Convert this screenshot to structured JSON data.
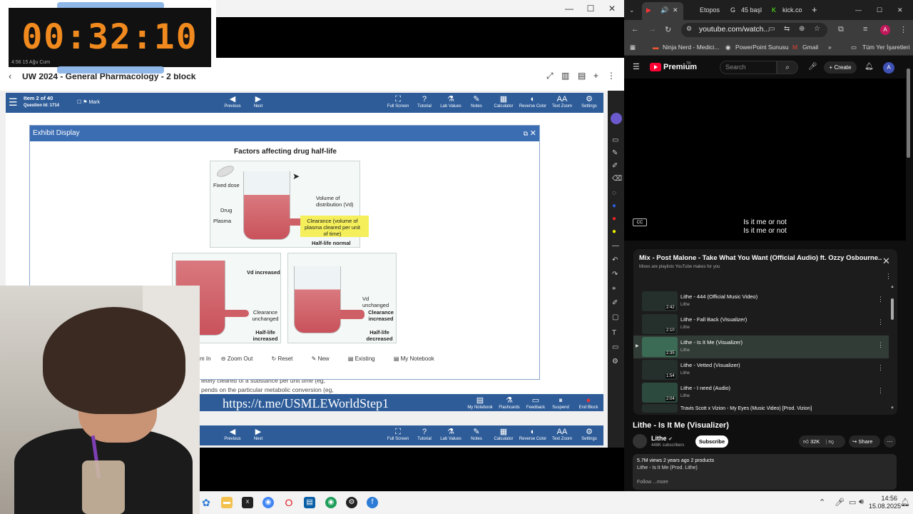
{
  "timer": {
    "time": "00:32:10",
    "date": "4:56 15 Ağu Cum"
  },
  "uworld": {
    "title": "UW 2024 - General Pharmacology - 2 block",
    "item": "Item 2 of 40",
    "question_id": "Question Id: 1714",
    "mark": "Mark",
    "nav": {
      "previous": "Previous",
      "next": "Next"
    },
    "tools": [
      "Full Screen",
      "Tutorial",
      "Lab Values",
      "Notes",
      "Calculator",
      "Reverse Color",
      "Text Zoom",
      "Settings"
    ],
    "bottom_tools": [
      "My Notebook",
      "Flashcards",
      "Feedback",
      "Suspend",
      "End Block"
    ],
    "overlay_url": "https://t.me/USMLEWorldStep1",
    "text_behind_1": "letely cleared of a substance per unit time (eg,",
    "text_behind_2": "pends on the particular metabolic conversion (eg,"
  },
  "exhibit": {
    "header": "Exhibit Display",
    "figure_title": "Factors affecting drug half-life",
    "labels": {
      "fixed_dose": "Fixed dose",
      "volume_dist": "Volume of distribution (Vd)",
      "drug": "Drug",
      "plasma": "Plasma",
      "clearance": "Clearance (volume of plasma cleared per unit of time)",
      "half_life_normal": "Half-life normal",
      "vd_increased": "Vd increased",
      "clearance_unchanged": "Clearance unchanged",
      "half_life_increased": "Half-life increased",
      "vd_unchanged": "Vd unchanged",
      "clearance_increased": "Clearance increased",
      "half_life_decreased": "Half-life decreased"
    },
    "toolbar": [
      "m In",
      "Zoom Out",
      "Reset",
      "New",
      "Existing",
      "My Notebook"
    ]
  },
  "browser": {
    "tabs": [
      "Etopos",
      "45 başl",
      "kick.co"
    ],
    "url": "youtube.com/watch...",
    "bookmarks": [
      "Ninja Nerd - Medici...",
      "PowerPoint Sunusu",
      "Gmail",
      "Tüm Yer İşaretleri"
    ],
    "profile_initial": "A"
  },
  "youtube": {
    "brand": "Premium",
    "country": "TR",
    "search_placeholder": "Search",
    "create": "Create",
    "avatar": "A",
    "caption_1": "Is it me or not",
    "caption_2": "Is it me or not",
    "playlist_title": "Mix - Post Malone - Take What You Want (Official Audio) ft. Ozzy Osbourne...",
    "playlist_sub": "Mixes are playlists YouTube makes for you",
    "playlist": [
      {
        "title": "Lithe - 444 (Official Music Video)",
        "channel": "Lithe",
        "duration": "2:42",
        "active": false
      },
      {
        "title": "Lithe - Fall Back (Visualizer)",
        "channel": "Lithe",
        "duration": "2:10",
        "active": false
      },
      {
        "title": "Lithe - Is It Me (Visualizer)",
        "channel": "Lithe",
        "duration": "2:35",
        "active": true
      },
      {
        "title": "Lithe - Vetted (Visualizer)",
        "channel": "Lithe",
        "duration": "1:54",
        "active": false
      },
      {
        "title": "Lithe - I need (Audio)",
        "channel": "Lithe",
        "duration": "2:04",
        "active": false
      },
      {
        "title": "Travis Scott x Vizion - My Eyes (Music Video) [Prod. Vizion]",
        "channel": "",
        "duration": "",
        "active": false
      }
    ],
    "video_title": "Lithe - Is It Me (Visualizer)",
    "channel": "Lithe",
    "subscribers": "448K subscribers",
    "subscribe": "Subscribe",
    "likes": "32K",
    "share": "Share",
    "stats": "5.7M views  2 years ago  2 products",
    "desc_line": "Lithe - Is It Me (Prod. Lithe)",
    "desc_more": "Follow  ...more"
  },
  "taskbar": {
    "time": "14:56",
    "date": "15.08.2025"
  }
}
